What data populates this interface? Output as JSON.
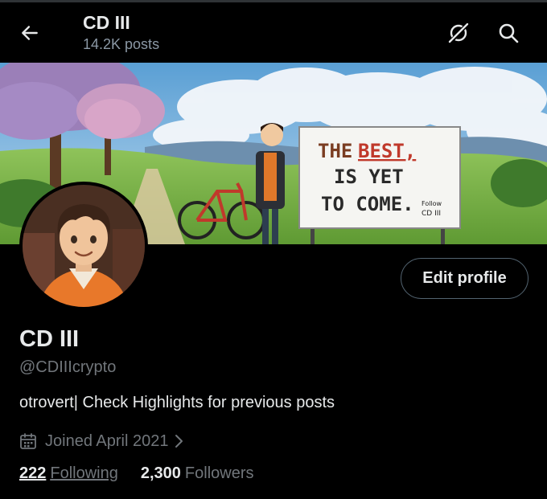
{
  "header": {
    "display_name": "CD III",
    "posts_count": "14.2K posts",
    "back_icon": "arrow-left-icon",
    "grok_icon": "grok-icon",
    "search_icon": "search-icon"
  },
  "banner": {
    "sign_line1": "THE",
    "sign_line1b": "BEST,",
    "sign_line2": "IS YET",
    "sign_line3": "TO COME.",
    "sign_small1": "Follow",
    "sign_small2": "CD III"
  },
  "profile": {
    "edit_button": "Edit profile",
    "name": "CD III",
    "handle": "@CDIIIcrypto",
    "bio": "otrovert| Check Highlights for previous posts",
    "joined": "Joined April 2021"
  },
  "stats": {
    "following_count": "222",
    "following_label": "Following",
    "followers_count": "2,300",
    "followers_label": "Followers"
  },
  "colors": {
    "background": "#000000",
    "text_primary": "#e7e9ea",
    "text_secondary": "#71767b",
    "button_border": "#536471"
  }
}
